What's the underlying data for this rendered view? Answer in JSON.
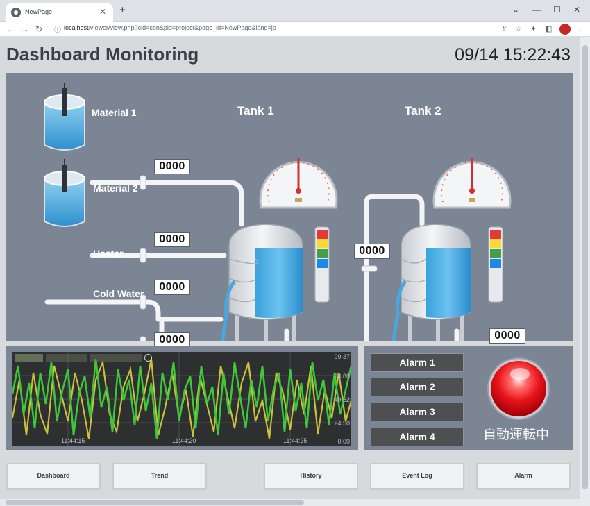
{
  "browser": {
    "tab_title": "NewPage",
    "url_host": "localhost",
    "url_path": "/viewer/view.php?cid=con&pid=project&page_id=NewPage&lang=jp"
  },
  "header": {
    "title": "Dashboard Monitoring",
    "clock": "09/14 15:22:43"
  },
  "process": {
    "inputs": [
      {
        "label": "Material 1",
        "value": "0000"
      },
      {
        "label": "Material 2",
        "value": "0000"
      },
      {
        "label": "Heater",
        "value": "0000"
      },
      {
        "label": "Cold Water",
        "value": "0000"
      }
    ],
    "tanks": [
      {
        "label": "Tank 1"
      },
      {
        "label": "Tank 2"
      }
    ],
    "transfer_value": "0000",
    "outlet_value": "0000",
    "signal_tower_colors": [
      "#e53935",
      "#fdd835",
      "#43a047",
      "#1e88e5",
      "#e0e0e0"
    ]
  },
  "trend": {
    "y_ticks": [
      "99.37",
      "74.80",
      "49.62",
      "24.50",
      "0.00"
    ],
    "x_ticks": [
      "11:44:15",
      "11:44:20",
      "11:44:25"
    ],
    "series_colors": [
      "#3ec73a",
      "#c9c23a"
    ]
  },
  "alarms": {
    "items": [
      "Alarm 1",
      "Alarm 2",
      "Alarm 3",
      "Alarm 4"
    ],
    "status_text": "自動運転中",
    "lamp_color": "#e8151a"
  },
  "nav": {
    "buttons": [
      "Dashboard",
      "Trend",
      "History",
      "Event Log",
      "Alarm"
    ]
  }
}
